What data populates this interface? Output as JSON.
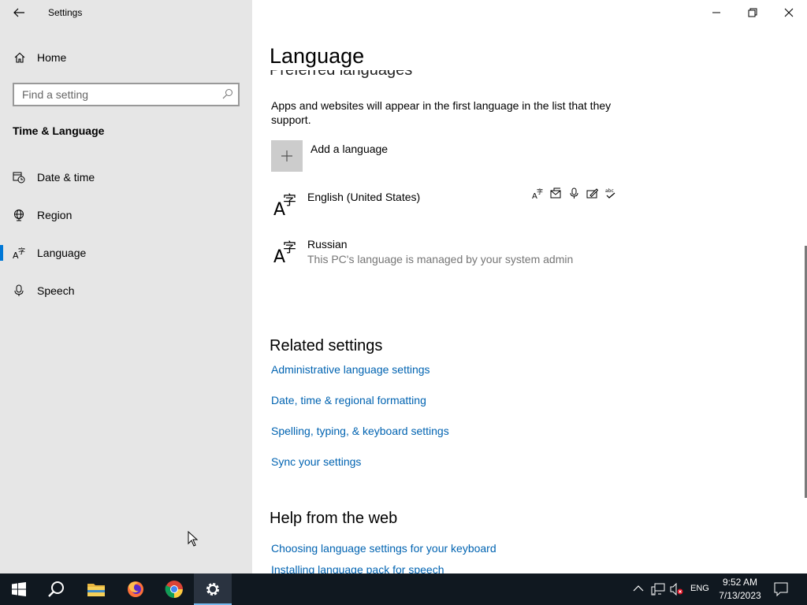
{
  "window": {
    "app_title": "Settings",
    "colors": {
      "accent": "#0078d7",
      "link": "#0063b1",
      "sidebar_bg": "#e6e6e6",
      "taskbar_bg": "#101820"
    }
  },
  "sidebar": {
    "home_label": "Home",
    "search_placeholder": "Find a setting",
    "section_title": "Time & Language",
    "items": [
      {
        "label": "Date & time",
        "icon": "calendar-clock-icon",
        "active": false
      },
      {
        "label": "Region",
        "icon": "globe-icon",
        "active": false
      },
      {
        "label": "Language",
        "icon": "language-icon",
        "active": true
      },
      {
        "label": "Speech",
        "icon": "microphone-icon",
        "active": false
      }
    ]
  },
  "main": {
    "page_title": "Language",
    "clipped_heading": "Preferred languages",
    "description": "Apps and websites will appear in the first language in the list that they support.",
    "add_language_label": "Add a language",
    "languages": [
      {
        "name": "English (United States)",
        "subtitle": "",
        "features": [
          "language-pack-icon",
          "display-language-icon",
          "speech-icon",
          "handwriting-icon",
          "spelling-icon"
        ]
      },
      {
        "name": "Russian",
        "subtitle": "This PC's language is managed by your system admin"
      }
    ],
    "related_settings": {
      "heading": "Related settings",
      "links": [
        "Administrative language settings",
        "Date, time & regional formatting",
        "Spelling, typing, & keyboard settings",
        "Sync your settings"
      ]
    },
    "help": {
      "heading": "Help from the web",
      "links": [
        "Choosing language settings for your keyboard",
        "Installing language pack for speech"
      ]
    }
  },
  "taskbar": {
    "apps": [
      "start-icon",
      "search-icon",
      "file-explorer-icon",
      "firefox-icon",
      "chrome-icon",
      "settings-icon"
    ],
    "input_language": "ENG",
    "time": "9:52 AM",
    "date": "7/13/2023"
  }
}
